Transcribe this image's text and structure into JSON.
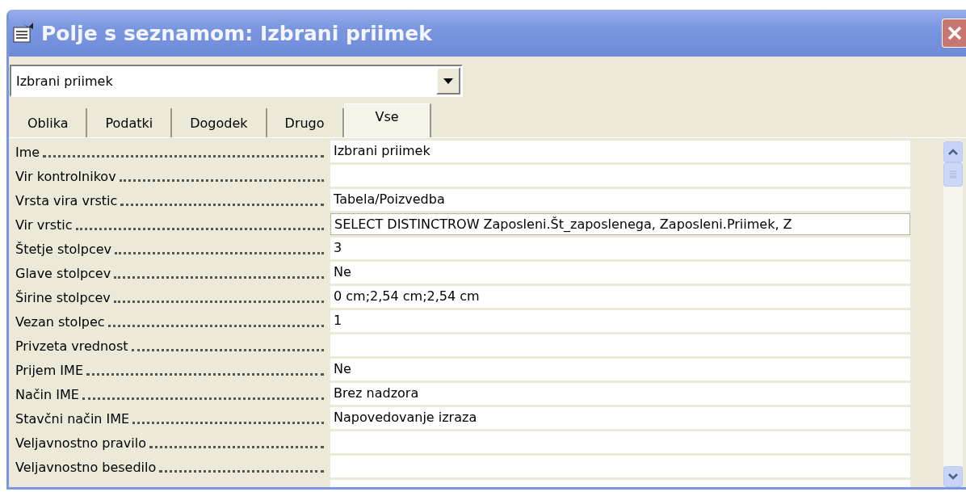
{
  "window": {
    "title": "Polje s seznamom: Izbrani priimek"
  },
  "object_selector": {
    "value": "Izbrani priimek"
  },
  "tabs": [
    {
      "label": "Oblika",
      "selected": false
    },
    {
      "label": "Podatki",
      "selected": false
    },
    {
      "label": "Dogodek",
      "selected": false
    },
    {
      "label": "Drugo",
      "selected": false
    },
    {
      "label": "Vse",
      "selected": true
    }
  ],
  "properties": [
    {
      "name": "Ime",
      "value": "Izbrani priimek",
      "selected": false
    },
    {
      "name": "Vir kontrolnikov",
      "selected": false
    },
    {
      "name": "Vrsta vira vrstic",
      "value": "Tabela/Poizvedba",
      "selected": false
    },
    {
      "name": "Vir vrstic",
      "value": "SELECT DISTINCTROW Zaposleni.Št_zaposlenega, Zaposleni.Priimek, Z",
      "selected": true
    },
    {
      "name": "Štetje stolpcev",
      "value": "3",
      "selected": false
    },
    {
      "name": "Glave stolpcev",
      "value": "Ne",
      "selected": false
    },
    {
      "name": "Širine stolpcev",
      "value": "0 cm;2,54 cm;2,54 cm",
      "selected": false
    },
    {
      "name": "Vezan stolpec",
      "value": "1",
      "selected": false
    },
    {
      "name": "Privzeta vrednost",
      "selected": false
    },
    {
      "name": "Prijem IME",
      "value": "Ne",
      "selected": false
    },
    {
      "name": "Način IME",
      "value": "Brez nadzora",
      "selected": false
    },
    {
      "name": "Stavčni način IME",
      "value": "Napovedovanje izraza",
      "selected": false
    },
    {
      "name": "Veljavnostno pravilo",
      "selected": false
    },
    {
      "name": "Veljavnostno besedilo",
      "selected": false
    }
  ]
}
